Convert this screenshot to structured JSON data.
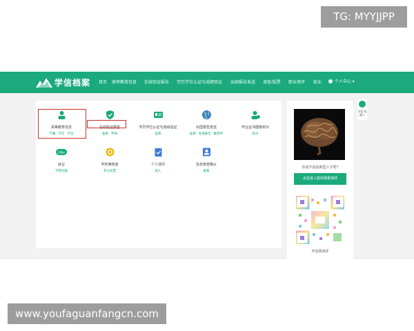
{
  "watermark": {
    "tag": "TG: MYYJJPP",
    "url": "www.youfaguanfangcn.com"
  },
  "header": {
    "logo_text": "学信档案",
    "nav": [
      "首页",
      "高等教育信息",
      "在线验证报告",
      "学历学位认证与成绩验证",
      "出国报告发送",
      "调查/投票",
      "职业测评",
      "就业"
    ],
    "user_menu": "个人中心 ▾"
  },
  "services": [
    {
      "icon": "person-icon",
      "title": "高等教育信息",
      "links": [
        "学籍",
        "学历",
        "学位"
      ],
      "highlighted": true
    },
    {
      "icon": "shield-check-icon",
      "title": "在线验证报告",
      "links": [
        "查看",
        "申请"
      ],
      "highlighted": true
    },
    {
      "icon": "id-card-icon",
      "title": "学历学位认证与成绩验证",
      "links": [
        "查看"
      ],
      "highlighted": false
    },
    {
      "icon": "globe-icon",
      "title": "出国报告发送",
      "links": [
        "查看",
        "发送报告",
        "翻译件"
      ],
      "highlighted": false
    },
    {
      "icon": "user-check-icon",
      "title": "毕业证书图像校对",
      "links": [
        "校对"
      ],
      "highlighted": false
    },
    {
      "icon": "offer-icon",
      "title": "就业",
      "links": [
        "学职问题"
      ],
      "highlighted": false
    },
    {
      "icon": "medal-icon",
      "title": "学校满意度",
      "links": [
        "参与投票"
      ],
      "highlighted": false
    },
    {
      "icon": "clipboard-icon",
      "title": "个人测评",
      "links": [
        "进入"
      ],
      "highlighted": false
    },
    {
      "icon": "profile-icon",
      "title": "信息核查确认",
      "links": [
        "查看"
      ],
      "highlighted": false
    }
  ],
  "sidebar": {
    "question": "你是不是追新型人才呢?",
    "button": "点击进入胜利场景测评",
    "qr_label": "学信网测评"
  },
  "float": {
    "label": "学信\n机器人"
  },
  "colors": {
    "brand": "#1aaa7b",
    "highlight": "#c9302c"
  }
}
